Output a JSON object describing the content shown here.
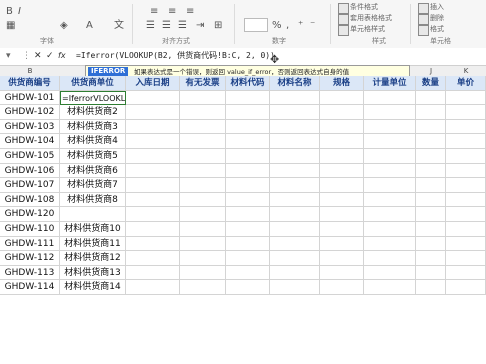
{
  "ribbon": {
    "groups": [
      {
        "id": "font",
        "label": "字体"
      },
      {
        "id": "alignment",
        "label": "对齐方式"
      },
      {
        "id": "number",
        "label": "数字"
      },
      {
        "id": "styles",
        "label": "样式"
      },
      {
        "id": "cells",
        "label": "单元格"
      }
    ],
    "number_format": "%",
    "cond_format_label": "条件格式",
    "table_format_label": "套用表格格式",
    "cell_style_label": "单元格样式",
    "insert_label": "插入",
    "delete_label": "删除",
    "format_label": "格式"
  },
  "formula_bar": {
    "formula": "=Iferror(VLOOKUP(B2, 供货商代码!B:C, 2, 0))"
  },
  "tooltip": {
    "function_name": "IFERROR",
    "text": "如果表达式是一个错误，则返回 value_if_error，否则返回表达式自身的值"
  },
  "columns": [
    "B",
    "C",
    "D",
    "E",
    "F",
    "G",
    "H",
    "I",
    "J",
    "K"
  ],
  "table": {
    "headers": [
      "供货商编号",
      "供货商单位",
      "入库日期",
      "有无发票",
      "材料代码",
      "材料名称",
      "规格",
      "计量单位",
      "数量",
      "单价"
    ],
    "rows": [
      {
        "code": "GHDW-101",
        "supplier": "=IferrorVLOOKL"
      },
      {
        "code": "GHDW-102",
        "supplier": "材料供货商2"
      },
      {
        "code": "GHDW-103",
        "supplier": "材料供货商3"
      },
      {
        "code": "GHDW-104",
        "supplier": "材料供货商4"
      },
      {
        "code": "GHDW-105",
        "supplier": "材料供货商5"
      },
      {
        "code": "GHDW-106",
        "supplier": "材料供货商6"
      },
      {
        "code": "GHDW-107",
        "supplier": "材料供货商7"
      },
      {
        "code": "GHDW-108",
        "supplier": "材料供货商8"
      },
      {
        "code": "GHDW-120",
        "supplier": ""
      },
      {
        "code": "GHDW-110",
        "supplier": "材料供货商10"
      },
      {
        "code": "GHDW-111",
        "supplier": "材料供货商11"
      },
      {
        "code": "GHDW-112",
        "supplier": "材料供货商12"
      },
      {
        "code": "GHDW-113",
        "supplier": "材料供货商13"
      },
      {
        "code": "GHDW-114",
        "supplier": "材料供货商14"
      }
    ]
  },
  "colors": {
    "header_bg": "#dbe7f7",
    "header_text": "#1a3f86",
    "tooltip_bg": "#ffffe1",
    "fn_highlight": "#2f6fd6",
    "edit_border": "#2e7d32"
  }
}
